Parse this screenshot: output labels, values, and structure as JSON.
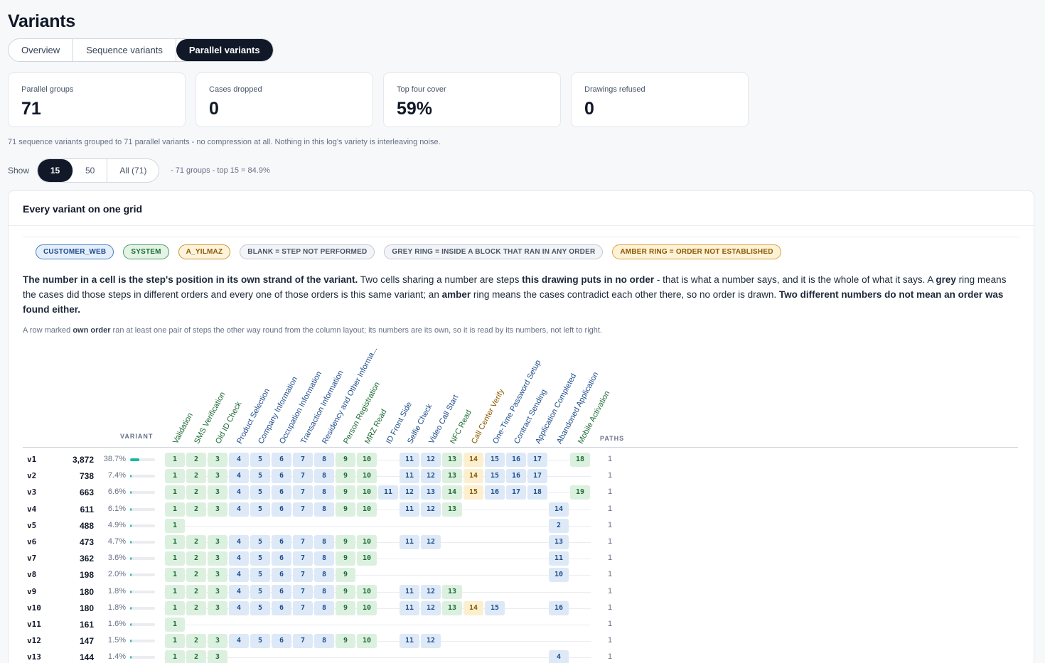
{
  "page": {
    "title": "Variants"
  },
  "tabs": [
    {
      "label": "Overview",
      "active": false
    },
    {
      "label": "Sequence variants",
      "active": false
    },
    {
      "label": "Parallel variants",
      "active": true
    }
  ],
  "stats": [
    {
      "label": "Parallel groups",
      "value": "71"
    },
    {
      "label": "Cases dropped",
      "value": "0"
    },
    {
      "label": "Top four cover",
      "value": "59%"
    },
    {
      "label": "Drawings refused",
      "value": "0"
    }
  ],
  "summary_note": "71 sequence variants grouped to 71 parallel variants - no compression at all. Nothing in this log's variety is interleaving noise.",
  "show": {
    "label": "Show",
    "options": [
      {
        "label": "15",
        "active": true
      },
      {
        "label": "50",
        "active": false
      },
      {
        "label": "All (71)",
        "active": false
      }
    ],
    "note": "- 71 groups - top 15 = 84.9%"
  },
  "card": {
    "title": "Every variant on one grid",
    "legend": [
      {
        "label": "CUSTOMER_WEB",
        "style": "blue"
      },
      {
        "label": "SYSTEM",
        "style": "green"
      },
      {
        "label": "A_YILMAZ",
        "style": "amber"
      },
      {
        "label": "BLANK = STEP NOT PERFORMED",
        "style": "grey"
      },
      {
        "label": "GREY RING = INSIDE A BLOCK THAT RAN IN ANY ORDER",
        "style": "grey"
      },
      {
        "label": "AMBER RING = ORDER NOT ESTABLISHED",
        "style": "amber2"
      }
    ],
    "explain": [
      {
        "text": "The number in a cell is the step's position in its own strand of the variant.",
        "bold": true
      },
      {
        "text": " Two cells sharing a number are steps ",
        "bold": false
      },
      {
        "text": "this drawing puts in no order",
        "bold": true
      },
      {
        "text": " - that is what a number says, and it is the whole of what it says. A ",
        "bold": false
      },
      {
        "text": "grey",
        "bold": true
      },
      {
        "text": " ring means the cases did those steps in different orders and every one of those orders is this same variant; an ",
        "bold": false
      },
      {
        "text": "amber",
        "bold": true
      },
      {
        "text": " ring means the cases contradict each other there, so no order is drawn. ",
        "bold": false
      },
      {
        "text": "Two different numbers do not mean an order was found either.",
        "bold": true
      }
    ],
    "subnote": [
      {
        "text": "A row marked ",
        "bold": false
      },
      {
        "text": "own order",
        "bold": true
      },
      {
        "text": " ran at least one pair of steps the other way round from the column layout; its numbers are its own, so it is read by its numbers, not left to right.",
        "bold": false
      }
    ]
  },
  "grid": {
    "variant_header": "VARIANT",
    "paths_header": "PATHS",
    "columns": [
      {
        "label": "Validation",
        "color": "green"
      },
      {
        "label": "SMS Verification",
        "color": "green"
      },
      {
        "label": "Old ID Check",
        "color": "green"
      },
      {
        "label": "Product Selection",
        "color": "blue"
      },
      {
        "label": "Company Information",
        "color": "blue"
      },
      {
        "label": "Occupation Information",
        "color": "blue"
      },
      {
        "label": "Transaction Information",
        "color": "blue"
      },
      {
        "label": "Residency and Other Informa...",
        "color": "blue"
      },
      {
        "label": "Person Registration",
        "color": "green"
      },
      {
        "label": "MRZ Read",
        "color": "green"
      },
      {
        "label": "ID Front Side",
        "color": "blue"
      },
      {
        "label": "Selfie Check",
        "color": "blue"
      },
      {
        "label": "Video Call Start",
        "color": "blue"
      },
      {
        "label": "NFC Read",
        "color": "green"
      },
      {
        "label": "Call Center Verify",
        "color": "amber"
      },
      {
        "label": "One-Time Password Setup",
        "color": "blue"
      },
      {
        "label": "Contract Sending",
        "color": "blue"
      },
      {
        "label": "Application Completed",
        "color": "blue"
      },
      {
        "label": "Abandoned Application",
        "color": "blue"
      },
      {
        "label": "Mobile Activation",
        "color": "green"
      }
    ],
    "rows": [
      {
        "name": "v1",
        "count": "3,872",
        "pct": "38.7%",
        "share": 0.387,
        "paths": "1",
        "cells": [
          "1",
          "2",
          "3",
          "4",
          "5",
          "6",
          "7",
          "8",
          "9",
          "10",
          "",
          "11",
          "12",
          "13",
          "14",
          "15",
          "16",
          "17",
          "",
          "18"
        ]
      },
      {
        "name": "v2",
        "count": "738",
        "pct": "7.4%",
        "share": 0.074,
        "paths": "1",
        "cells": [
          "1",
          "2",
          "3",
          "4",
          "5",
          "6",
          "7",
          "8",
          "9",
          "10",
          "",
          "11",
          "12",
          "13",
          "14",
          "15",
          "16",
          "17",
          "",
          ""
        ]
      },
      {
        "name": "v3",
        "count": "663",
        "pct": "6.6%",
        "share": 0.066,
        "paths": "1",
        "cells": [
          "1",
          "2",
          "3",
          "4",
          "5",
          "6",
          "7",
          "8",
          "9",
          "10",
          "11",
          "12",
          "13",
          "14",
          "15",
          "16",
          "17",
          "18",
          "",
          "19"
        ]
      },
      {
        "name": "v4",
        "count": "611",
        "pct": "6.1%",
        "share": 0.061,
        "paths": "1",
        "cells": [
          "1",
          "2",
          "3",
          "4",
          "5",
          "6",
          "7",
          "8",
          "9",
          "10",
          "",
          "11",
          "12",
          "13",
          "",
          "",
          "",
          "",
          "14",
          ""
        ]
      },
      {
        "name": "v5",
        "count": "488",
        "pct": "4.9%",
        "share": 0.049,
        "paths": "1",
        "cells": [
          "1",
          "",
          "",
          "",
          "",
          "",
          "",
          "",
          "",
          "",
          "",
          "",
          "",
          "",
          "",
          "",
          "",
          "",
          "2",
          ""
        ]
      },
      {
        "name": "v6",
        "count": "473",
        "pct": "4.7%",
        "share": 0.047,
        "paths": "1",
        "cells": [
          "1",
          "2",
          "3",
          "4",
          "5",
          "6",
          "7",
          "8",
          "9",
          "10",
          "",
          "11",
          "12",
          "",
          "",
          "",
          "",
          "",
          "13",
          ""
        ]
      },
      {
        "name": "v7",
        "count": "362",
        "pct": "3.6%",
        "share": 0.036,
        "paths": "1",
        "cells": [
          "1",
          "2",
          "3",
          "4",
          "5",
          "6",
          "7",
          "8",
          "9",
          "10",
          "",
          "",
          "",
          "",
          "",
          "",
          "",
          "",
          "11",
          ""
        ]
      },
      {
        "name": "v8",
        "count": "198",
        "pct": "2.0%",
        "share": 0.02,
        "paths": "1",
        "cells": [
          "1",
          "2",
          "3",
          "4",
          "5",
          "6",
          "7",
          "8",
          "9",
          "",
          "",
          "",
          "",
          "",
          "",
          "",
          "",
          "",
          "10",
          ""
        ]
      },
      {
        "name": "v9",
        "count": "180",
        "pct": "1.8%",
        "share": 0.018,
        "paths": "1",
        "cells": [
          "1",
          "2",
          "3",
          "4",
          "5",
          "6",
          "7",
          "8",
          "9",
          "10",
          "",
          "11",
          "12",
          "13",
          "",
          "",
          "",
          "",
          "",
          ""
        ]
      },
      {
        "name": "v10",
        "count": "180",
        "pct": "1.8%",
        "share": 0.018,
        "paths": "1",
        "cells": [
          "1",
          "2",
          "3",
          "4",
          "5",
          "6",
          "7",
          "8",
          "9",
          "10",
          "",
          "11",
          "12",
          "13",
          "14",
          "15",
          "",
          "",
          "16",
          ""
        ]
      },
      {
        "name": "v11",
        "count": "161",
        "pct": "1.6%",
        "share": 0.016,
        "paths": "1",
        "cells": [
          "1",
          "",
          "",
          "",
          "",
          "",
          "",
          "",
          "",
          "",
          "",
          "",
          "",
          "",
          "",
          "",
          "",
          "",
          "",
          ""
        ]
      },
      {
        "name": "v12",
        "count": "147",
        "pct": "1.5%",
        "share": 0.015,
        "paths": "1",
        "cells": [
          "1",
          "2",
          "3",
          "4",
          "5",
          "6",
          "7",
          "8",
          "9",
          "10",
          "",
          "11",
          "12",
          "",
          "",
          "",
          "",
          "",
          "",
          ""
        ]
      },
      {
        "name": "v13",
        "count": "144",
        "pct": "1.4%",
        "share": 0.014,
        "paths": "1",
        "cells": [
          "1",
          "2",
          "3",
          "",
          "",
          "",
          "",
          "",
          "",
          "",
          "",
          "",
          "",
          "",
          "",
          "",
          "",
          "",
          "4",
          ""
        ]
      }
    ]
  },
  "colors": {
    "blue_cell": "#dde9f7",
    "green_cell": "#dcf0df",
    "amber_cell": "#fbefcf",
    "bar_fill": "#14b8a6",
    "active_dark": "#111827"
  }
}
